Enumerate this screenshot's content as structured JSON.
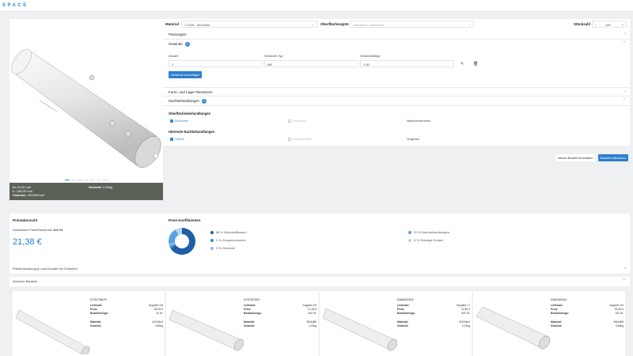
{
  "brand": "SPACE",
  "viewer": {
    "dim_d": "45,96 mm",
    "dim_l": "198,00 mm",
    "volume": "300300mm³",
    "weight": "2,89kg",
    "labels": {
      "d": "D:",
      "l": "L:",
      "volume": "Volumen:",
      "weight": "Gewicht:"
    }
  },
  "config": {
    "material_label": "Material",
    "material_value": "1.7225 - 42CrMo4",
    "surface_label": "Oberflächengüte",
    "surface_placeholder": "Oberfläche auswählen",
    "qty_label": "Stückzahl",
    "qty_minus": "−",
    "qty_value": "100",
    "qty_plus": "+"
  },
  "sections": {
    "passungen": "Passungen",
    "gewinde": "Gewinde",
    "gewinde_count": "1",
    "thread_cols": [
      "Anzahl",
      "Gewinde-Typ",
      "Gewindelänge"
    ],
    "thread_row": [
      "1",
      "M8",
      "1,00"
    ],
    "add_thread": "Gewinde hinzufügen",
    "form_lage": "Form- und Lage-Toleranzen",
    "nachbehandlungen": "Nachbehandlungen",
    "nach_count": "1",
    "oberflaechen": "Oberflächenbehandlungen",
    "brunieren": "Brünieren",
    "verzinken": "Verzinken",
    "nachverchromen": "Nachverchromen",
    "haertende": "Härtende Nachbehandlungen",
    "haerten": "Härten",
    "einsatzhaerten": "Einsatzhärten",
    "verguten": "Vergüten",
    "reset": "Neues Bauteil hochladen",
    "calc": "Bauteil kalkulieren"
  },
  "price": {
    "title": "Preisübersicht",
    "desc": "Kalkulierter Preis/Einheit bei",
    "qty": "100 St.",
    "value": "21,38 €"
  },
  "coefficients": {
    "title": "Preis Koeffizienten",
    "items": [
      {
        "label": "66 % Werkstoffkosten",
        "color": "#1f5fa6"
      },
      {
        "label": "3 % Zerspanvolumen",
        "color": "#3a8bd1"
      },
      {
        "label": "3 % Gewinde",
        "color": "#8fb9e2"
      },
      {
        "label": "20 % Nachbehandlungen",
        "color": "#5aa3e0"
      },
      {
        "label": "8 % Sonstige Kosten",
        "color": "#b8d4ef"
      }
    ],
    "pie": [
      66,
      3,
      3,
      20,
      8
    ]
  },
  "bars": {
    "volume_discount": "Preisentwicklung je nach Anzahl der Einheiten",
    "similar_parts": "Ähnliche Bauteile"
  },
  "card_labels": {
    "supplier": "Lieferant:",
    "price": "Preis:",
    "qty": "Bestellmenge:",
    "material": "Material:",
    "weight": "Gewicht:"
  },
  "cards": [
    {
      "id": "D73279679",
      "supplier": "Supplier G6",
      "price": "35,05 €",
      "qty": "24 St.",
      "material": "42CrMo4",
      "weight": "2,80kg"
    },
    {
      "id": "D70767957",
      "supplier": "Supplier K9",
      "price": "17,28 €",
      "qty": "300 St.",
      "material": "30MnB5",
      "weight": "2,21kg"
    },
    {
      "id": "D64631332",
      "supplier": "Supplier L7",
      "price": "11,89 €",
      "qty": "500 St.",
      "material": "42CrMo4",
      "weight": "2,21kg"
    },
    {
      "id": "D83333151",
      "supplier": "Supplier D4",
      "price": "33,08 €",
      "qty": "100 St.",
      "material": "30MnB5",
      "weight": "3,69kg"
    }
  ]
}
